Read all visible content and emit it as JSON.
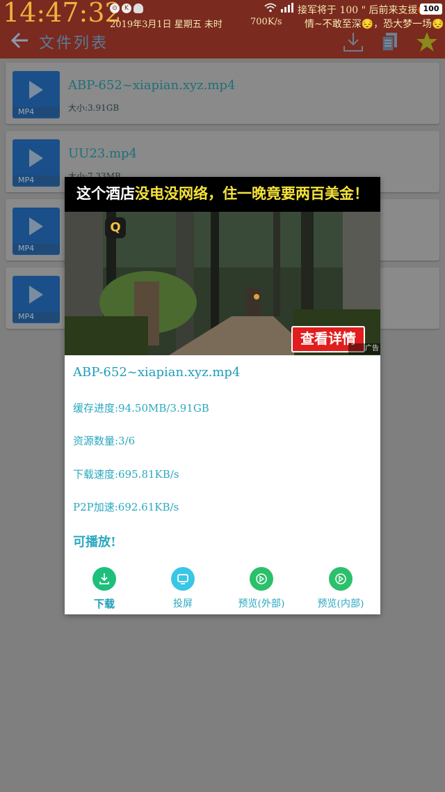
{
  "status_bar": {
    "time": "14:47:32",
    "date": "2019年3月1日 星期五 未时",
    "speed": "700K/s",
    "icon_a": "⊙",
    "icon_b": "K",
    "message_line1": "接军将于 100 \" 后前来支援😡",
    "message_line2": "情~不敢至深😔，恐大梦一场😔",
    "battery": "100"
  },
  "toolbar": {
    "title": "文件列表"
  },
  "files": [
    {
      "name": "ABP-652~xiapian.xyz.mp4",
      "size": "大小:3.91GB",
      "format": "MP4"
    },
    {
      "name": "UU23.mp4",
      "size": "大小:7.33MB",
      "format": "MP4"
    },
    {
      "name": "",
      "size": "",
      "format": "MP4"
    },
    {
      "name": "",
      "size": "",
      "format": "MP4"
    }
  ],
  "dialog": {
    "ad": {
      "headline_pre": "这个酒店",
      "headline_highlight": "没电没网络，住一晚竟要两百美金！",
      "button": "查看详情",
      "badge": "广告",
      "logo": "Q"
    },
    "filename": "ABP-652~xiapian.xyz.mp4",
    "cache_progress": "缓存进度:94.50MB/3.91GB",
    "resource_count": "资源数量:3/6",
    "download_speed": "下载速度:695.81KB/s",
    "p2p_speed": "P2P加速:692.61KB/s",
    "playable": "可播放!",
    "actions": {
      "download": "下载",
      "cast": "投屏",
      "preview_external": "预览(外部)",
      "preview_internal": "预览(内部)"
    }
  },
  "colors": {
    "status_bar": "#7a2a1e",
    "accent": "#2aa8c0",
    "download_green": "#1dbf7a",
    "cast_blue": "#3ac6e6",
    "preview_green": "#2bc06a"
  }
}
